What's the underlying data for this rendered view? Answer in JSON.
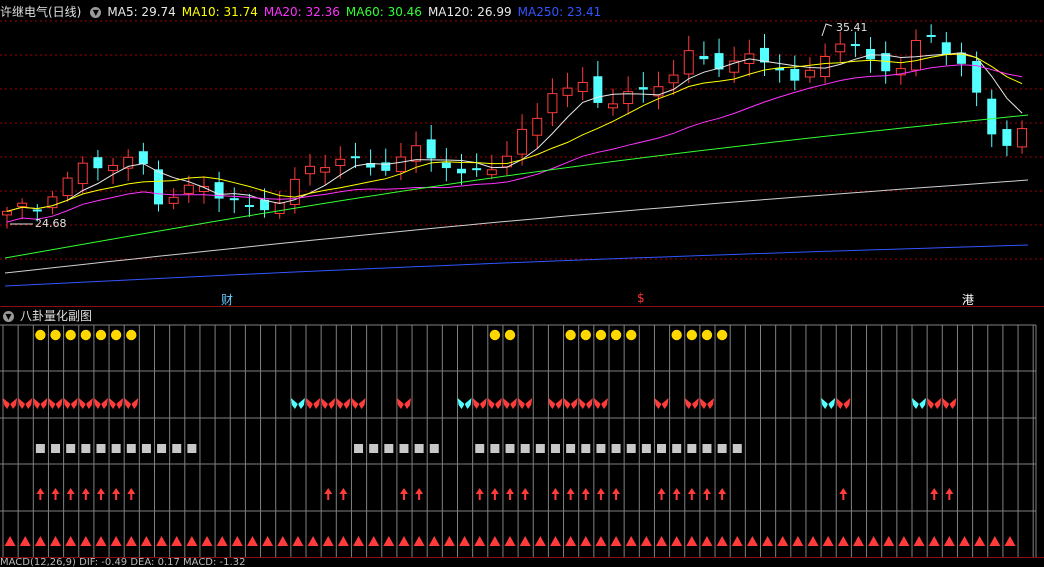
{
  "price_panel": {
    "stock_title": "许继电气(日线)",
    "indicators": [
      {
        "label": "MA5: 29.74",
        "color": "#e8e8e8"
      },
      {
        "label": "MA10: 31.74",
        "color": "#ffff00"
      },
      {
        "label": "MA20: 32.36",
        "color": "#ff33ff"
      },
      {
        "label": "MA60: 30.46",
        "color": "#33ff33"
      },
      {
        "label": "MA120: 26.99",
        "color": "#e8e8e8"
      },
      {
        "label": "MA250: 23.41",
        "color": "#3355ff"
      }
    ],
    "high_marker": "35.41",
    "low_marker": "24.68",
    "event_tags": [
      {
        "text": "财",
        "color": "#66ccff"
      },
      {
        "text": "$",
        "color": "#ff3333"
      },
      {
        "text": "港",
        "color": "#ffffff"
      }
    ]
  },
  "gua_panel": {
    "title": "八卦量化副图",
    "rows": {
      "dots": [
        2,
        3,
        4,
        5,
        6,
        7,
        8,
        32,
        33,
        37,
        38,
        39,
        40,
        41,
        44,
        45,
        46,
        47
      ],
      "butterflies": [
        {
          "i": 0,
          "c": "r"
        },
        {
          "i": 1,
          "c": "r"
        },
        {
          "i": 2,
          "c": "r"
        },
        {
          "i": 3,
          "c": "r"
        },
        {
          "i": 4,
          "c": "r"
        },
        {
          "i": 5,
          "c": "r"
        },
        {
          "i": 6,
          "c": "r"
        },
        {
          "i": 7,
          "c": "r"
        },
        {
          "i": 8,
          "c": "r"
        },
        {
          "i": 19,
          "c": "c"
        },
        {
          "i": 20,
          "c": "r"
        },
        {
          "i": 21,
          "c": "r"
        },
        {
          "i": 22,
          "c": "r"
        },
        {
          "i": 23,
          "c": "r"
        },
        {
          "i": 26,
          "c": "r"
        },
        {
          "i": 30,
          "c": "c"
        },
        {
          "i": 31,
          "c": "r"
        },
        {
          "i": 32,
          "c": "r"
        },
        {
          "i": 33,
          "c": "r"
        },
        {
          "i": 34,
          "c": "r"
        },
        {
          "i": 36,
          "c": "r"
        },
        {
          "i": 37,
          "c": "r"
        },
        {
          "i": 38,
          "c": "r"
        },
        {
          "i": 39,
          "c": "r"
        },
        {
          "i": 43,
          "c": "r"
        },
        {
          "i": 45,
          "c": "r"
        },
        {
          "i": 46,
          "c": "r"
        },
        {
          "i": 54,
          "c": "c"
        },
        {
          "i": 55,
          "c": "r"
        },
        {
          "i": 60,
          "c": "c"
        },
        {
          "i": 61,
          "c": "r"
        },
        {
          "i": 62,
          "c": "r"
        }
      ],
      "squares": [
        2,
        3,
        4,
        5,
        6,
        7,
        8,
        9,
        10,
        11,
        12,
        23,
        24,
        25,
        26,
        27,
        28,
        31,
        32,
        33,
        34,
        35,
        36,
        37,
        38,
        39,
        40,
        41,
        42,
        43,
        44,
        45,
        46,
        47,
        48
      ],
      "arrows": [
        2,
        3,
        4,
        5,
        6,
        7,
        8,
        21,
        22,
        26,
        27,
        31,
        32,
        33,
        34,
        36,
        37,
        38,
        39,
        40,
        43,
        44,
        45,
        46,
        47,
        55,
        61,
        62
      ],
      "triangles_count": 67
    }
  },
  "bottom_strip": {
    "text": "MACD(12,26,9)  DIF: -0.49  DEA: 0.17  MACD: -1.32"
  },
  "colors": {
    "up": "#ff3b3b",
    "down": "#54ffff",
    "grid": "#a00000",
    "sub_grid": "#808080",
    "gold": "#ffd800",
    "square": "#c8c8c8"
  }
}
